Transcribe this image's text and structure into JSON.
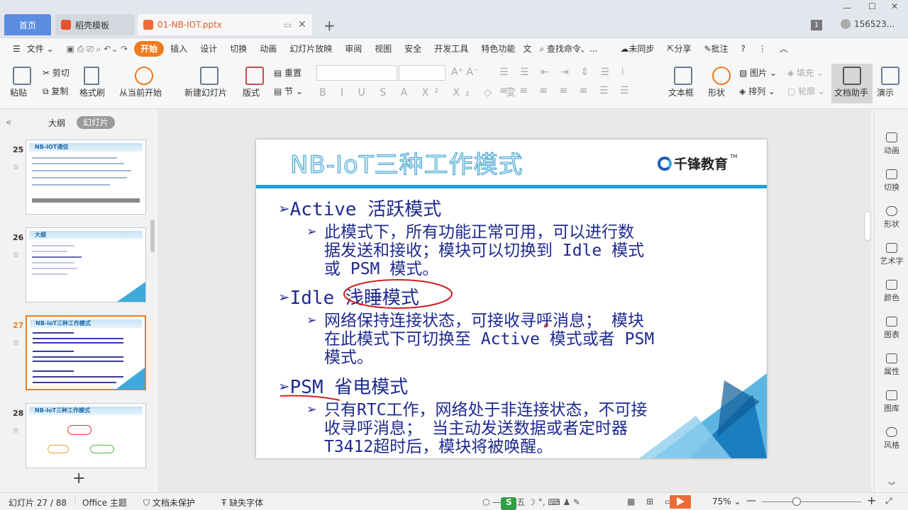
{
  "tabs": {
    "home": "首页",
    "template": "稻壳模板",
    "file": "01-NB-IOT.pptx",
    "badge": "1",
    "user": "156523..."
  },
  "menu": {
    "file": "文件",
    "items": [
      "开始",
      "插入",
      "设计",
      "切换",
      "动画",
      "幻灯片放映",
      "审阅",
      "视图",
      "安全",
      "开发工具",
      "特色功能",
      "文"
    ],
    "search": "查找命令、...",
    "sync": "未同步",
    "share": "分享",
    "annotate": "批注",
    "help": "?"
  },
  "ribbon": {
    "paste": "粘贴",
    "cut": "剪切",
    "copy": "复制",
    "format_painter": "格式刷",
    "from_current": "从当前开始",
    "new_slide": "新建幻灯片",
    "layout": "版式",
    "reset": "重置",
    "section": "节",
    "textbox": "文本框",
    "shape": "形状",
    "picture": "图片",
    "fill": "填充",
    "arrange": "排列",
    "outline": "轮廓",
    "doc_helper": "文档助手",
    "present": "演示"
  },
  "left_panel": {
    "outline_tab": "大纲",
    "slides_tab": "幻灯片",
    "thumbs": [
      {
        "num": "25",
        "title": "NB-IOT通信"
      },
      {
        "num": "26",
        "title": "大纲"
      },
      {
        "num": "27",
        "title": "NB-IoT三种工作模式"
      },
      {
        "num": "28",
        "title": "NB-IoT三种工作模式"
      }
    ],
    "add": "+"
  },
  "slide": {
    "title": "NB-IoT三种工作模式",
    "logo": "千锋教育",
    "tm": "TM",
    "b1": "Active 活跃模式",
    "b1s_1": "此模式下，所有功能正常可用，可以进行数",
    "b1s_2": "据发送和接收；模块可以切换到 Idle 模式",
    "b1s_3": "或 PSM 模式。",
    "b2": "Idle 浅睡模式",
    "b2s_1": "网络保持连接状态，可接收寻呼消息； 模块",
    "b2s_2": "在此模式下可切换至 Active 模式或者 PSM",
    "b2s_3": "模式。",
    "b3": "PSM 省电模式",
    "b3s_1": "只有RTC工作，网络处于非连接状态，不可接",
    "b3s_2": "收寻呼消息； 当主动发送数据或者定时器",
    "b3s_3": "T3412超时后，模块将被唤醒。"
  },
  "right_bar": [
    "动画",
    "切换",
    "形状",
    "艺术字",
    "颜色",
    "图表",
    "属性",
    "图库",
    "风格"
  ],
  "status": {
    "slide_counter": "幻灯片 27 / 88",
    "theme": "Office 主题",
    "protect": "文档未保护",
    "missing_font": "缺失字体",
    "ime": "五",
    "zoom": "75%"
  },
  "colors": {
    "accent": "#f07b1d",
    "home_tab": "#5b8de1",
    "slide_text": "#1e2a8f",
    "slide_bar": "#1da1d8"
  }
}
